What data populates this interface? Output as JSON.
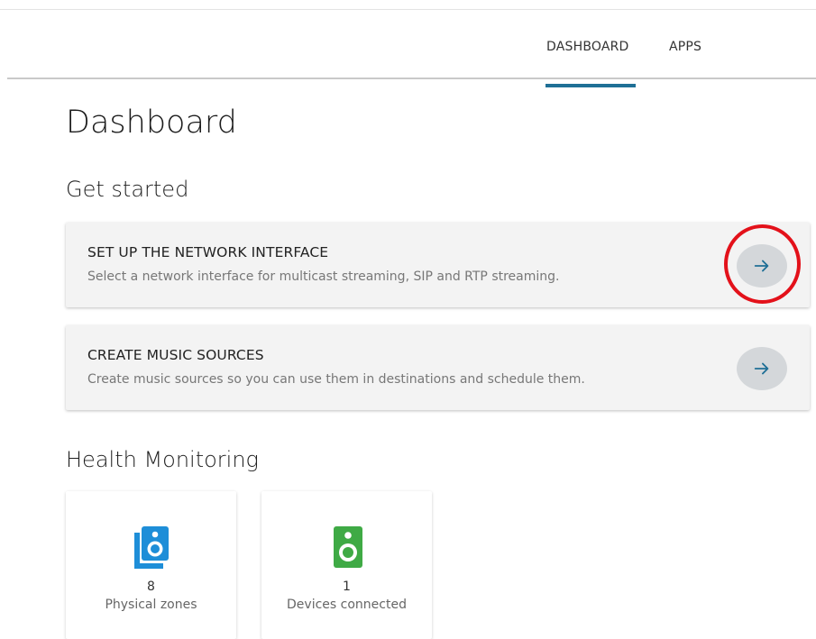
{
  "nav": {
    "tabs": [
      {
        "label": "DASHBOARD",
        "active": true
      },
      {
        "label": "APPS",
        "active": false
      }
    ],
    "accent_color": "#1f6f96"
  },
  "page": {
    "title": "Dashboard"
  },
  "get_started": {
    "title": "Get started",
    "cards": [
      {
        "title": "SET UP THE NETWORK INTERFACE",
        "description": "Select a network interface for multicast streaming, SIP and RTP streaming.",
        "action_icon": "arrow-right-icon"
      },
      {
        "title": "CREATE MUSIC SOURCES",
        "description": "Create music sources so you can use them in destinations and schedule them.",
        "action_icon": "arrow-right-icon"
      }
    ]
  },
  "health": {
    "title": "Health Monitoring",
    "tiles": [
      {
        "count": "8",
        "label": "Physical zones",
        "icon": "speakers-icon",
        "color": "#1e8ed8"
      },
      {
        "count": "1",
        "label": "Devices connected",
        "icon": "speaker-icon",
        "color": "#3faa45"
      }
    ]
  },
  "annotation": {
    "highlight_color": "#e3111a"
  }
}
